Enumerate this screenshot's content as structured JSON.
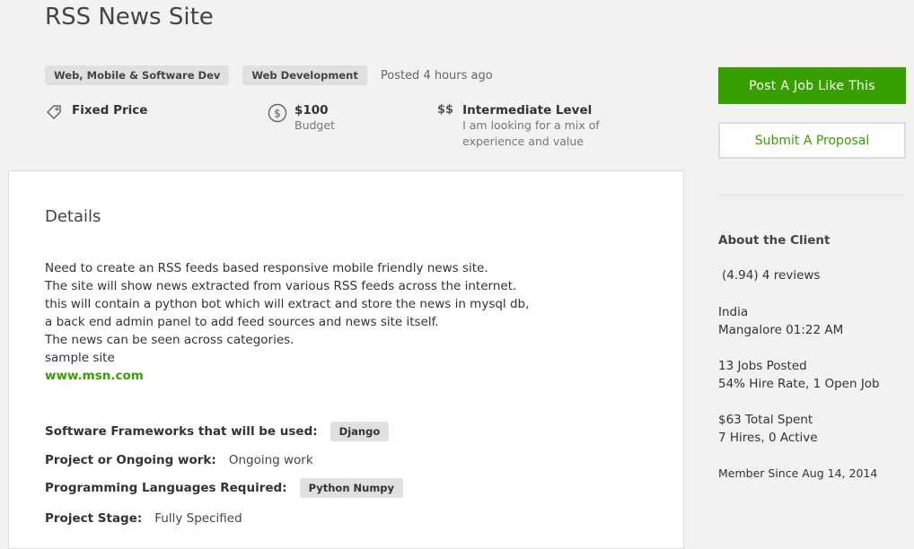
{
  "job": {
    "title": "RSS News Site",
    "tags": [
      "Web, Mobile & Software Dev",
      "Web Development"
    ],
    "posted": "Posted 4 hours ago",
    "price_type": "Fixed Price",
    "budget_value": "$100",
    "budget_label": "Budget",
    "level_icon": "$$",
    "level": "Intermediate Level",
    "level_desc_1": "I am looking for a mix of",
    "level_desc_2": "experience and value"
  },
  "details": {
    "heading": "Details",
    "lines": [
      "Need to create an RSS feeds based responsive mobile friendly news site.",
      "The site will show news extracted from various RSS feeds across the internet.",
      "this will contain a python bot which will extract and store the news in mysql db,",
      "a back end admin panel to add feed sources and news site itself.",
      "The news can be seen across categories.",
      "sample site"
    ],
    "link": "www.msn.com",
    "frameworks_label": "Software Frameworks that will be used:",
    "frameworks_value": "Django",
    "project_label": "Project or Ongoing work:",
    "project_value": "Ongoing work",
    "languages_label": "Programming Languages Required:",
    "languages_value": "Python Numpy",
    "stage_label": "Project Stage:",
    "stage_value": "Fully Specified"
  },
  "actions": {
    "post_job": "Post A Job Like This",
    "submit_proposal": "Submit A Proposal"
  },
  "client": {
    "heading": "About the Client",
    "rating": "(4.94) 4 reviews",
    "country": "India",
    "location_time": "Mangalore 01:22 AM",
    "jobs_posted": "13 Jobs Posted",
    "hire_rate": "54% Hire Rate, 1 Open Job",
    "total_spent": "$63 Total Spent",
    "hires": "7 Hires, 0 Active",
    "member_since": "Member Since Aug 14, 2014"
  },
  "colors": {
    "accent": "#37a000",
    "background": "#f2f2f2"
  }
}
